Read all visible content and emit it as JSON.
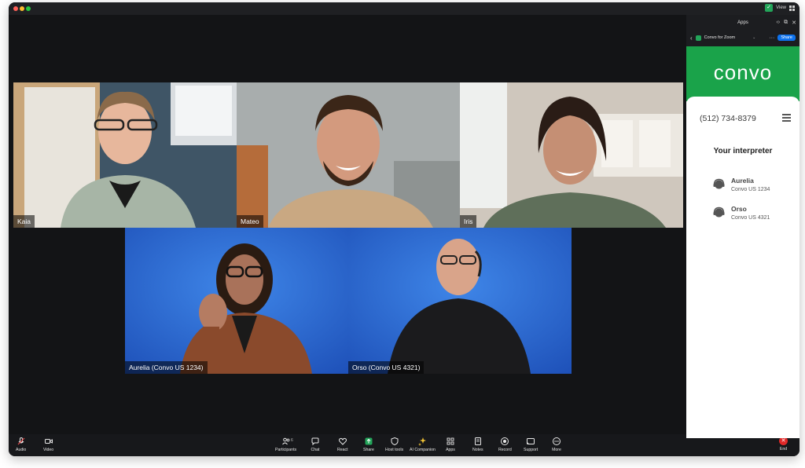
{
  "window": {
    "view_label": "View"
  },
  "panel": {
    "title": "Apps",
    "app_name": "Convo for Zoom",
    "share_label": "Share",
    "brand": "convo",
    "phone": "(512) 734-8379",
    "heading": "Your interpreter",
    "interpreters": [
      {
        "name": "Aurelia",
        "id": "Convo US 1234"
      },
      {
        "name": "Orso",
        "id": "Convo US 4321"
      }
    ]
  },
  "participants": [
    {
      "name": "Kaia"
    },
    {
      "name": "Mateo"
    },
    {
      "name": "Iris"
    },
    {
      "name": "Aurelia (Convo US 1234)"
    },
    {
      "name": "Orso (Convo US 4321)"
    }
  ],
  "toolbar": {
    "audio": "Audio",
    "video": "Video",
    "participants": "Participants",
    "participant_count": "6",
    "chat": "Chat",
    "react": "React",
    "share": "Share",
    "host_tools": "Host tools",
    "ai_companion": "AI Companion",
    "apps": "Apps",
    "notes": "Notes",
    "record": "Record",
    "support": "Support",
    "more": "More",
    "end": "End"
  },
  "colors": {
    "brand_green": "#1aa34a",
    "share_blue": "#0e72ed",
    "end_red": "#e02828",
    "interpreter_bg": "#1f5fd1"
  }
}
